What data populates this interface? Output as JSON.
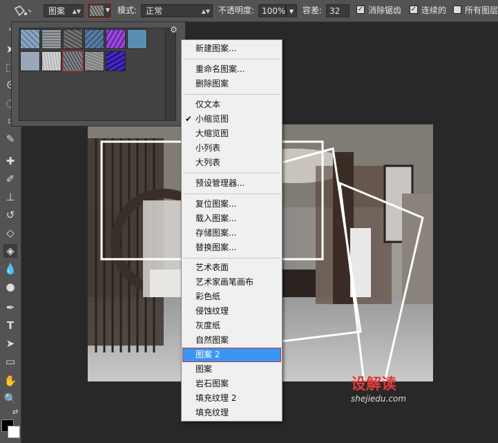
{
  "optbar": {
    "preset_label": "图案",
    "mode_label": "模式:",
    "mode_value": "正常",
    "opacity_label": "不透明度:",
    "opacity_value": "100%",
    "tolerance_label": "容差:",
    "tolerance_value": "32",
    "antialias_label": "消除锯齿",
    "contiguous_label": "连续的",
    "all_layers_label": "所有图层"
  },
  "pattern_picker": {
    "swatch_colors": [
      "#7d98b4",
      "#8a8f95",
      "#6a6a6a",
      "#4c6f93",
      "#8a3ec8",
      "#5a8eb0",
      "#9aa7b8",
      "#c8c8c8",
      "#5e6368",
      "#8c8c8c",
      "#3a1aa8"
    ],
    "selected_index": 8
  },
  "menu": {
    "groups": [
      [
        "新建图案..."
      ],
      [
        "重命名图案...",
        "删除图案"
      ],
      [
        "仅文本",
        "小缩览图",
        "大缩览图",
        "小列表",
        "大列表"
      ],
      [
        "预设管理器..."
      ],
      [
        "复位图案...",
        "载入图案...",
        "存储图案...",
        "替换图案..."
      ],
      [
        "艺术表面",
        "艺术家画笔画布",
        "彩色纸",
        "侵蚀纹理",
        "灰度纸",
        "自然图案",
        "图案 2",
        "图案",
        "岩石图案",
        "填充纹理 2",
        "填充纹理"
      ]
    ],
    "checked_item": "小缩览图",
    "highlighted_item": "图案 2"
  },
  "watermark": {
    "brand": "设解读",
    "url": "shejiedu.com"
  }
}
